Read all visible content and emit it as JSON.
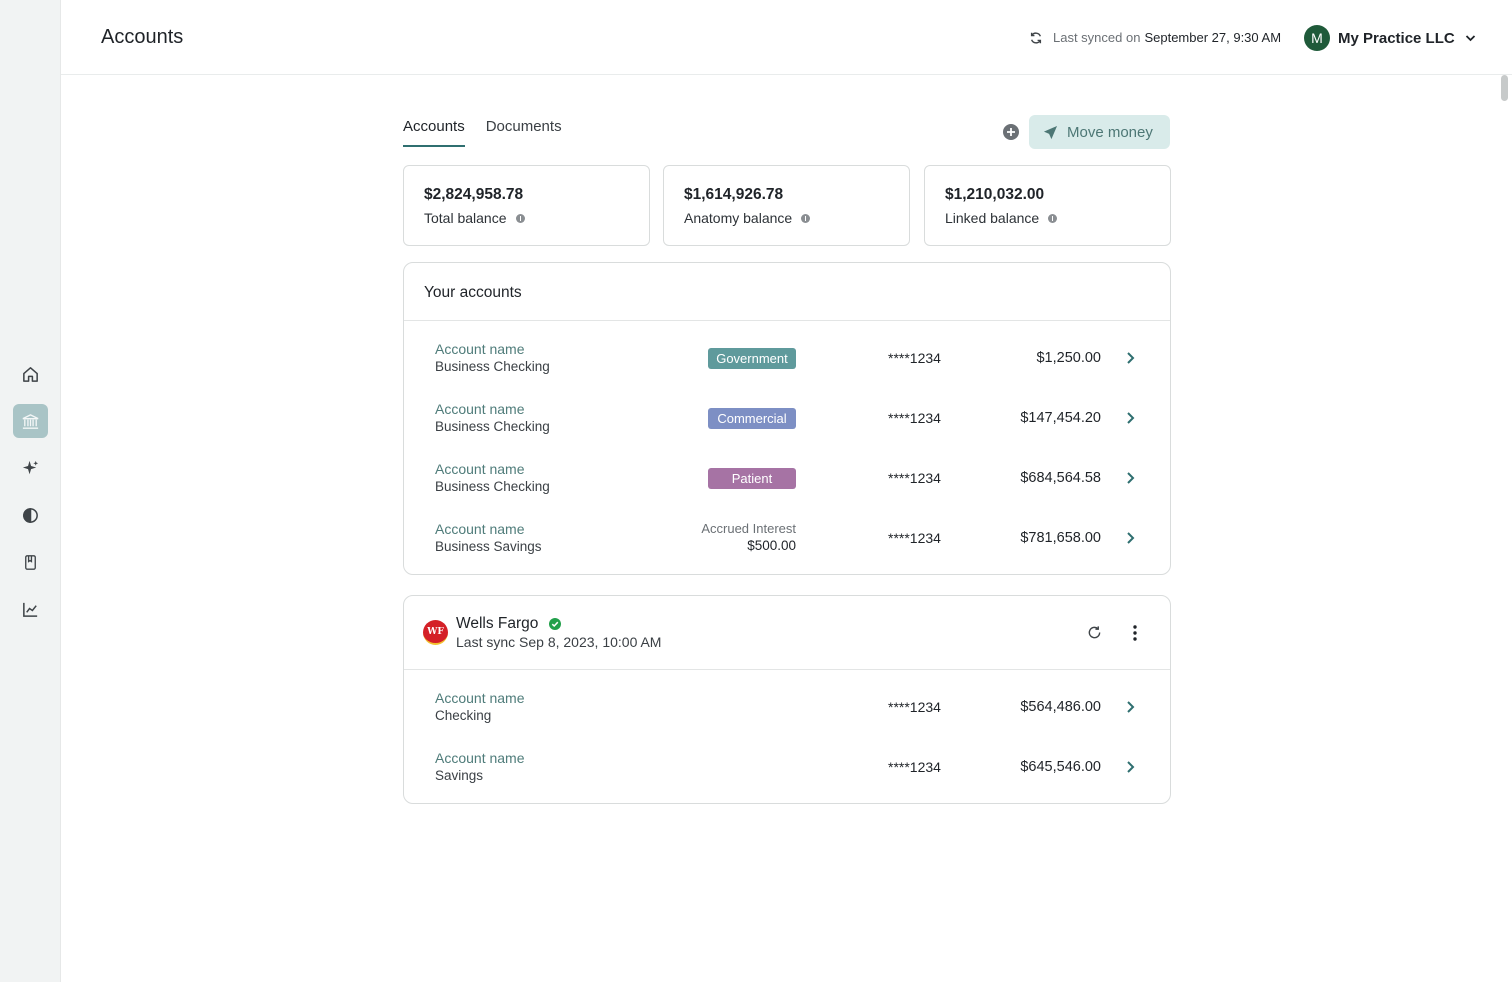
{
  "header": {
    "title": "Accounts",
    "sync_label": "Last synced on",
    "sync_value": "September 27, 9:30 AM",
    "org_initial": "M",
    "org_name": "My Practice LLC"
  },
  "sidebar": {
    "items": [
      {
        "name": "home-icon",
        "active": false
      },
      {
        "name": "bank-icon",
        "active": true
      },
      {
        "name": "sparkle-icon",
        "active": false
      },
      {
        "name": "circle-icon",
        "active": false
      },
      {
        "name": "document-icon",
        "active": false
      },
      {
        "name": "chart-icon",
        "active": false
      }
    ]
  },
  "tabs": [
    {
      "label": "Accounts",
      "active": true
    },
    {
      "label": "Documents",
      "active": false
    }
  ],
  "actions": {
    "move_money": "Move money"
  },
  "summary": [
    {
      "amount": "$2,824,958.78",
      "label": "Total balance"
    },
    {
      "amount": "$1,614,926.78",
      "label": "Anatomy balance"
    },
    {
      "amount": "$1,210,032.00",
      "label": "Linked balance"
    }
  ],
  "your_accounts": {
    "title": "Your accounts",
    "rows": [
      {
        "name": "Account name",
        "type": "Business Checking",
        "badge": "Government",
        "badge_color": "#5f9a9c",
        "number": "****1234",
        "balance": "$1,250.00"
      },
      {
        "name": "Account name",
        "type": "Business Checking",
        "badge": "Commercial",
        "badge_color": "#7d8fc4",
        "number": "****1234",
        "balance": "$147,454.20"
      },
      {
        "name": "Account name",
        "type": "Business Checking",
        "badge": "Patient",
        "badge_color": "#a673a4",
        "number": "****1234",
        "balance": "$684,564.58"
      },
      {
        "name": "Account name",
        "type": "Business Savings",
        "accrued_label": "Accrued Interest",
        "accrued_value": "$500.00",
        "number": "****1234",
        "balance": "$781,658.00"
      }
    ]
  },
  "linked_bank": {
    "logo_text": "WF",
    "name": "Wells Fargo",
    "last_sync": "Last sync Sep 8, 2023, 10:00 AM",
    "rows": [
      {
        "name": "Account name",
        "type": "Checking",
        "number": "****1234",
        "balance": "$564,486.00"
      },
      {
        "name": "Account name",
        "type": "Savings",
        "number": "****1234",
        "balance": "$645,546.00"
      }
    ]
  }
}
